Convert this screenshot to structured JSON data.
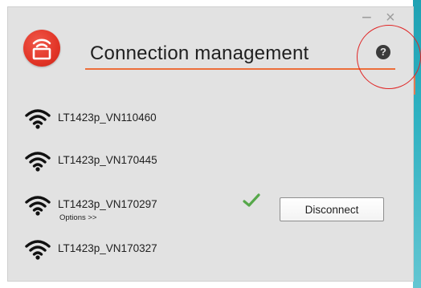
{
  "window": {
    "title": "Connection management",
    "minimize_glyph": "−",
    "close_glyph": "×",
    "help_glyph": "?"
  },
  "colors": {
    "accent_underline": "#ec6e3b",
    "logo_red": "#e23527",
    "check_green": "#56a84a",
    "annotation_red": "#e02424",
    "window_bg": "#e2e2e2"
  },
  "icons": {
    "logo": "router-icon",
    "help": "help-icon",
    "network": "wifi-icon",
    "connected": "check-icon"
  },
  "networks": [
    {
      "name": "LT1423p_VN110460"
    },
    {
      "name": "LT1423p_VN170445"
    },
    {
      "name": "LT1423p_VN170297",
      "connected": true,
      "options_label": "Options >>",
      "action_label": "Disconnect"
    },
    {
      "name": "LT1423p_VN170327"
    }
  ]
}
